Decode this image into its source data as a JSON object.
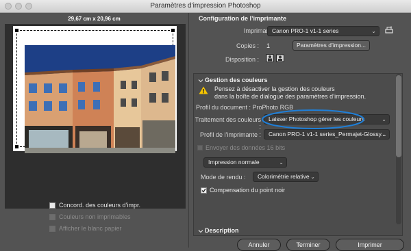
{
  "window": {
    "title": "Paramètres d’impression Photoshop"
  },
  "preview": {
    "size_label": "29,67 cm x 20,96 cm"
  },
  "left_options": [
    {
      "label": "Concord. des couleurs d’impr.",
      "checked": false,
      "enabled": true
    },
    {
      "label": "Couleurs non imprimables",
      "checked": false,
      "enabled": false
    },
    {
      "label": "Afficher le blanc papier",
      "checked": false,
      "enabled": false
    }
  ],
  "printer_config": {
    "section_title": "Configuration de l’imprimante",
    "printer_label": "Imprimante :",
    "printer_value": "Canon PRO-1 v1-1 series",
    "copies_label": "Copies :",
    "copies_value": "1",
    "print_settings_button": "Paramètres d’impression...",
    "layout_label": "Disposition :"
  },
  "color_management": {
    "section_title": "Gestion des couleurs",
    "warning_line1": "Pensez à désactiver la gestion des couleurs",
    "warning_line2": "dans la boîte de dialogue des paramètres d’impression.",
    "document_profile": "Profil du document : ProPhoto RGB",
    "color_handling_label": "Traitement des couleurs :",
    "color_handling_value": "Laisser Photoshop gérer les couleurs",
    "printer_profile_label": "Profil de l’imprimante :",
    "printer_profile_value": "Canon PRO-1 v1-1 series_Permajet-Glossy...",
    "send_16bit": "Envoyer des données 16 bits",
    "print_mode_value": "Impression normale",
    "rendering_label": "Mode de rendu :",
    "rendering_value": "Colorimétrie relative",
    "black_point": "Compensation du point noir",
    "black_point_checked": true
  },
  "description_section": {
    "title": "Description"
  },
  "buttons": {
    "cancel": "Annuler",
    "done": "Terminer",
    "print": "Imprimer"
  },
  "colors": {
    "highlight_oval": "#1f7fd8",
    "warning": "#f5c400",
    "sky": "#1d3f86"
  }
}
